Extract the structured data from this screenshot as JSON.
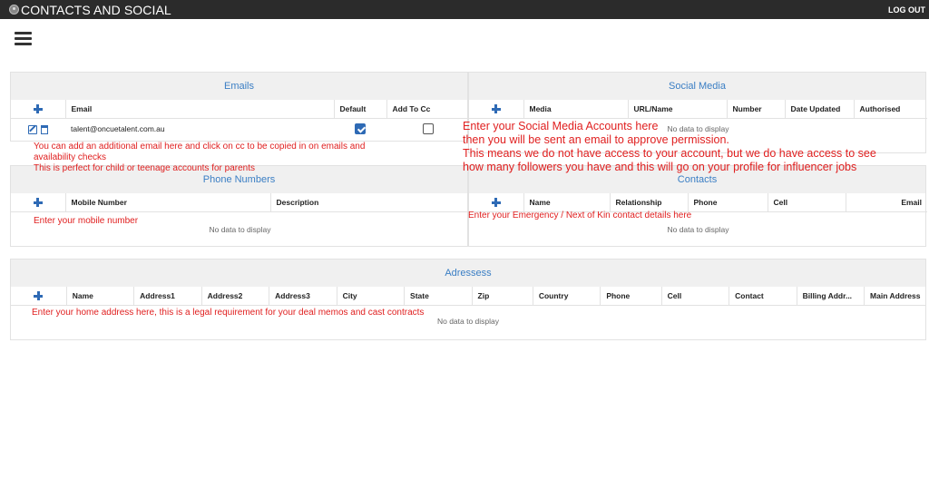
{
  "app": {
    "title": "CONTACTS AND SOCIAL",
    "logout_label": "LOG OUT"
  },
  "emails": {
    "title": "Emails",
    "columns": [
      "Email",
      "Default",
      "Add To Cc"
    ],
    "rows": [
      {
        "email": "talent@oncuetalent.com.au",
        "default": true,
        "add_to_cc": false
      }
    ],
    "note_lines": [
      "You can add an additional email here and click on cc to be copied in on emails and",
      "availability checks",
      "This is perfect for child or teenage accounts for parents"
    ]
  },
  "social": {
    "title": "Social Media",
    "columns": [
      "Media",
      "URL/Name",
      "Number",
      "Date Updated",
      "Authorised"
    ],
    "no_data": "No data to display",
    "note_lines": [
      "Enter your Social Media Accounts here",
      "then you will be sent an email to approve permission.",
      "This means we do not have access to your account, but we do have access to see",
      "how many followers you have and this will go on your profile for influencer jobs"
    ]
  },
  "phones": {
    "title": "Phone Numbers",
    "columns": [
      "Mobile Number",
      "Description"
    ],
    "no_data": "No data to display",
    "note": "Enter your mobile number"
  },
  "contacts": {
    "title": "Contacts",
    "columns": [
      "Name",
      "Relationship",
      "Phone",
      "Cell",
      "Email"
    ],
    "no_data": "No data to display",
    "note": "Enter your Emergency / Next of Kin contact details here"
  },
  "addresses": {
    "title": "Adressess",
    "columns": [
      "Name",
      "Address1",
      "Address2",
      "Address3",
      "City",
      "State",
      "Zip",
      "Country",
      "Phone",
      "Cell",
      "Contact",
      "Billing Addr...",
      "Main Address"
    ],
    "no_data": "No data to display",
    "note": "Enter your home address here, this is a legal requirement for your deal memos and cast contracts"
  }
}
